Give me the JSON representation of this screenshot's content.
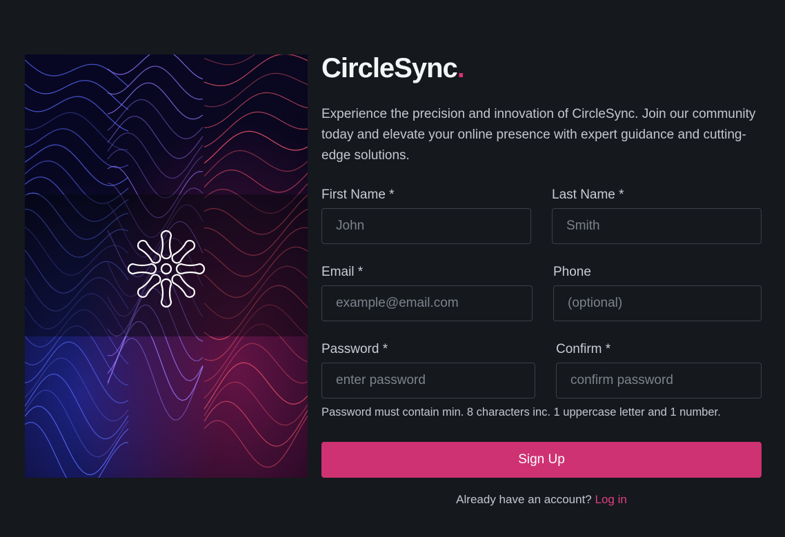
{
  "brand": {
    "name": "CircleSync",
    "dot": ".",
    "accent_color": "#d63472"
  },
  "intro": "Experience the precision and innovation of CircleSync. Join our community today and elevate your online presence with expert guidance and cutting-edge solutions.",
  "hero": {
    "icon": "circlesync-logo-icon"
  },
  "form": {
    "first_name": {
      "label": "First Name *",
      "placeholder": "John"
    },
    "last_name": {
      "label": "Last Name *",
      "placeholder": "Smith"
    },
    "email": {
      "label": "Email *",
      "placeholder": "example@email.com"
    },
    "phone": {
      "label": "Phone",
      "placeholder": "(optional)"
    },
    "password": {
      "label": "Password *",
      "placeholder": "enter password"
    },
    "confirm": {
      "label": "Confirm *",
      "placeholder": "confirm password"
    },
    "password_hint": "Password must contain min. 8 characters inc. 1 uppercase letter and 1 number.",
    "submit_label": "Sign Up",
    "submit_color": "#cf3272"
  },
  "footer": {
    "prompt": "Already have an account?",
    "login_label": "Log in"
  }
}
